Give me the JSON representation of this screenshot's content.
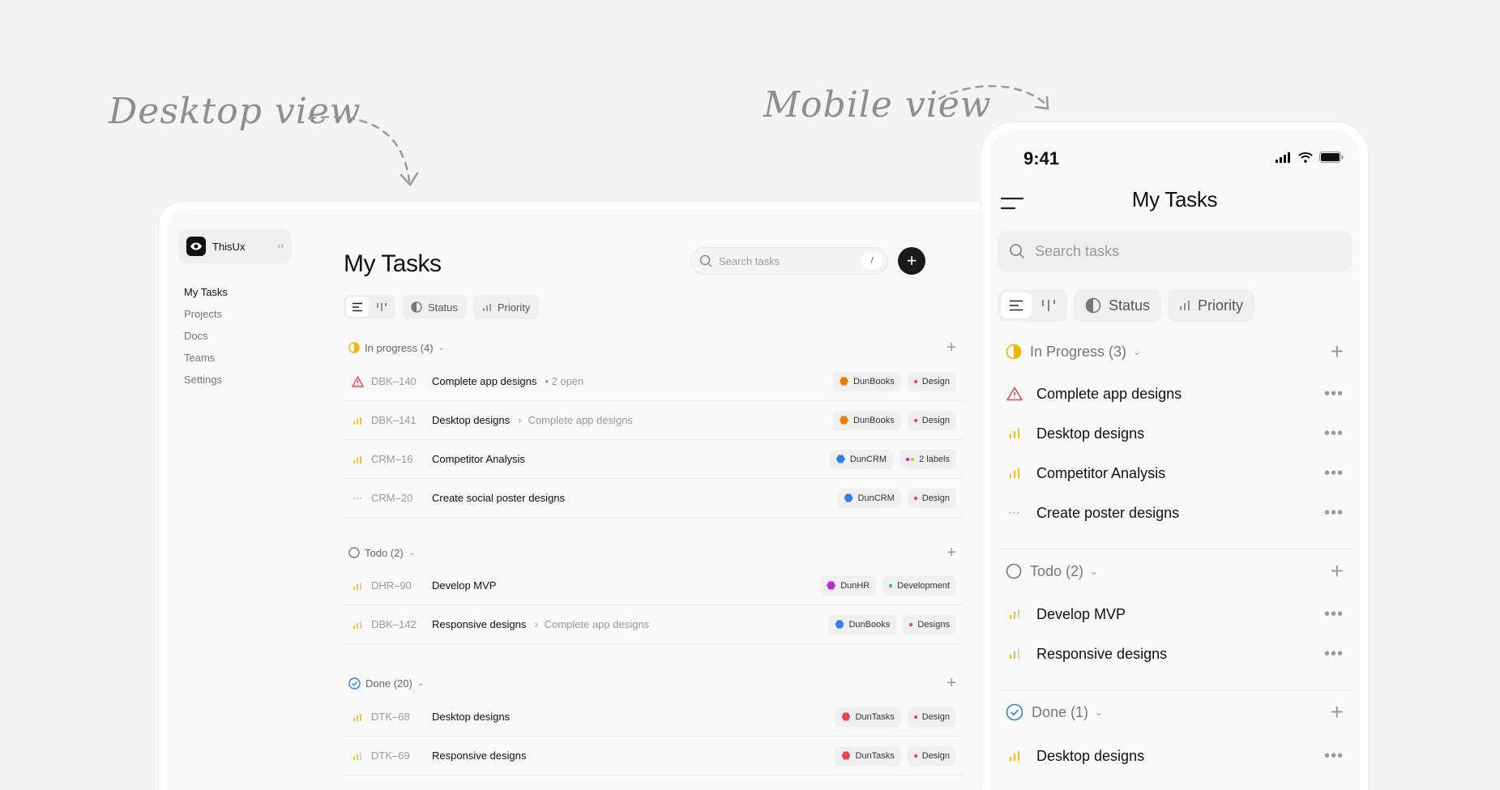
{
  "annotations": {
    "desktop": "Desktop view",
    "mobile": "Mobile view"
  },
  "colors": {
    "accent": "#f5b400",
    "urgent": "#e5484d",
    "done": "#2f80ed",
    "dark": "#1a1a1a"
  },
  "desktop": {
    "workspace": "ThisUx",
    "nav": [
      "My Tasks",
      "Projects",
      "Docs",
      "Teams",
      "Settings"
    ],
    "title": "My Tasks",
    "search_placeholder": "Search tasks",
    "shortcut": "/",
    "filters": {
      "status": "Status",
      "priority": "Priority"
    },
    "groups": [
      {
        "label": "In progress (4)",
        "rows": [
          {
            "id": "DBK–140",
            "title": "Complete app designs",
            "sub": "• 2 open",
            "project": "DunBooks",
            "label": "Design"
          },
          {
            "id": "DBK–141",
            "title": "Desktop designs",
            "sub": "Complete app designs",
            "project": "DunBooks",
            "label": "Design"
          },
          {
            "id": "CRM–16",
            "title": "Competitor Analysis",
            "sub": "",
            "project": "DunCRM",
            "label": "2 labels"
          },
          {
            "id": "CRM–20",
            "title": "Create social poster designs",
            "sub": "",
            "project": "DunCRM",
            "label": "Design"
          }
        ]
      },
      {
        "label": "Todo (2)",
        "rows": [
          {
            "id": "DHR–90",
            "title": "Develop MVP",
            "sub": "",
            "project": "DunHR",
            "label": "Development"
          },
          {
            "id": "DBK–142",
            "title": "Responsive designs",
            "sub": "Complete app designs",
            "project": "DunBooks",
            "label": "Designs"
          }
        ]
      },
      {
        "label": "Done (20)",
        "rows": [
          {
            "id": "DTK–68",
            "title": "Desktop designs",
            "sub": "",
            "project": "DunTasks",
            "label": "Design"
          },
          {
            "id": "DTK–69",
            "title": "Responsive designs",
            "sub": "",
            "project": "DunTasks",
            "label": "Design"
          }
        ]
      }
    ]
  },
  "mobile": {
    "time": "9:41",
    "title": "My Tasks",
    "search_placeholder": "Search tasks",
    "filters": {
      "status": "Status",
      "priority": "Priority"
    },
    "groups": [
      {
        "label": "In Progress (3)",
        "rows": [
          "Complete app designs",
          "Desktop designs",
          "Competitor Analysis",
          "Create poster designs"
        ]
      },
      {
        "label": "Todo (2)",
        "rows": [
          "Develop MVP",
          "Responsive designs"
        ]
      },
      {
        "label": "Done (1)",
        "rows": [
          "Desktop designs"
        ]
      }
    ],
    "more": "•••"
  }
}
